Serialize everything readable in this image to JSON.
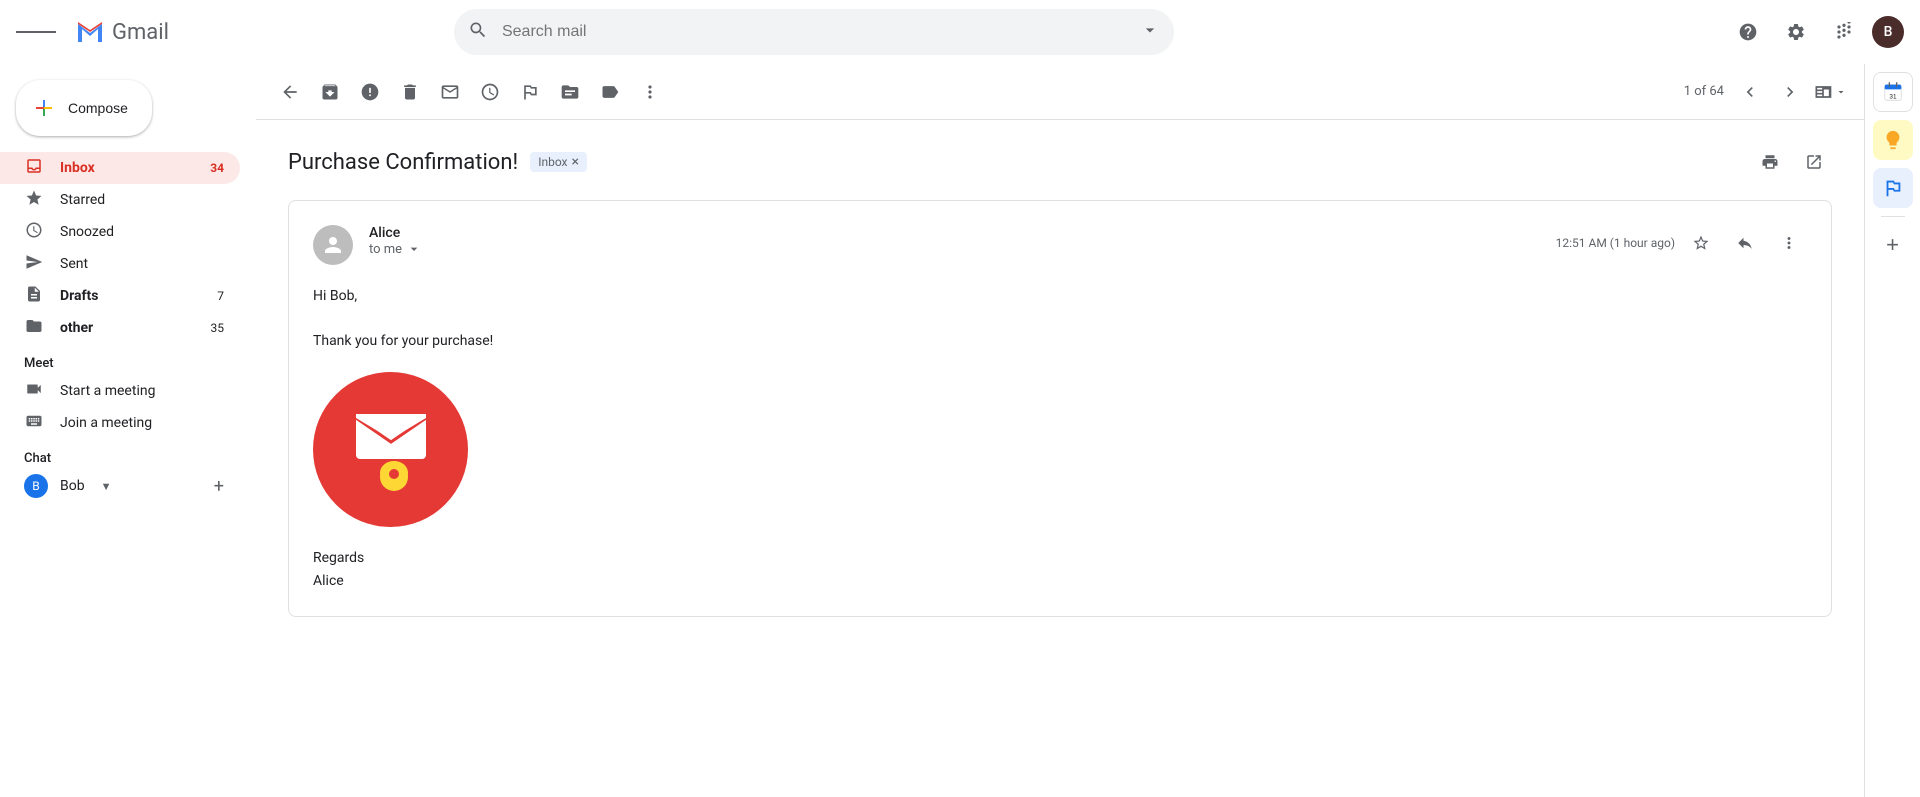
{
  "topbar": {
    "search_placeholder": "Search mail",
    "help_icon": "?",
    "settings_icon": "⚙",
    "apps_icon": "⋮⋮⋮",
    "avatar_letter": "B"
  },
  "sidebar": {
    "compose_label": "Compose",
    "nav_items": [
      {
        "id": "inbox",
        "label": "Inbox",
        "icon": "inbox",
        "count": "34",
        "active": true
      },
      {
        "id": "starred",
        "label": "Starred",
        "icon": "star",
        "count": "",
        "active": false
      },
      {
        "id": "snoozed",
        "label": "Snoozed",
        "icon": "clock",
        "count": "",
        "active": false
      },
      {
        "id": "sent",
        "label": "Sent",
        "icon": "send",
        "count": "",
        "active": false
      },
      {
        "id": "drafts",
        "label": "Drafts",
        "icon": "draft",
        "count": "7",
        "active": false
      },
      {
        "id": "other",
        "label": "other",
        "icon": "folder",
        "count": "35",
        "active": false
      }
    ],
    "meet_section": "Meet",
    "start_meeting": "Start a meeting",
    "join_meeting": "Join a meeting",
    "chat_section": "Chat",
    "chat_user": "Bob",
    "chat_add": "+"
  },
  "toolbar": {
    "pagination": "1 of 64"
  },
  "email": {
    "subject": "Purchase Confirmation!",
    "badge": "Inbox",
    "sender_name": "Alice",
    "sender_to": "to me",
    "timestamp": "12:51 AM (1 hour ago)",
    "greeting": "Hi Bob,",
    "body": "Thank you for your purchase!",
    "sign_off": "Regards",
    "sign_name": "Alice"
  }
}
